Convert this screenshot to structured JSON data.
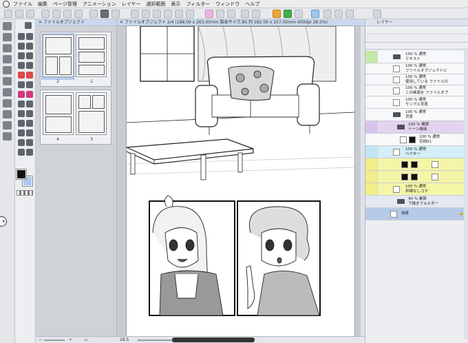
{
  "menu": {
    "items": [
      "ファイル",
      "編集",
      "ページ管理",
      "アニメーション",
      "レイヤー",
      "選択範囲",
      "表示",
      "フィルター",
      "ウィンドウ",
      "ヘルプ"
    ]
  },
  "page_manager": {
    "tab_label": "ファイルオブジェクト",
    "pages": [
      {
        "number": "2"
      },
      {
        "number": "1"
      },
      {
        "number": "4"
      },
      {
        "number": "3"
      }
    ]
  },
  "canvas": {
    "tab_label": "ファイルオブジェクト 2/4 (188.00 x 263.00mm 製本サイズ:85 判 182.00 x 257.00mm 600dpi 28.5%)",
    "zoom": "28.5"
  },
  "layer_panel": {
    "tab_label": "レイヤー",
    "layers": [
      {
        "line1": "100 % 通常",
        "line2": "テキスト",
        "tint": "#f5f5a8",
        "eye_color": "#c2e9a5"
      },
      {
        "line1": "100 % 通常",
        "line2": "ファイルオブジェクトに",
        "tint": "#f7f8fa",
        "eye_color": ""
      },
      {
        "line1": "100 % 通常",
        "line2": "使用している ファイルの",
        "tint": "#f7f8fa",
        "eye_color": ""
      },
      {
        "line1": "100 % 通常",
        "line2": "この画面を ファイルオブ",
        "tint": "#f7f8fa",
        "eye_color": ""
      },
      {
        "line1": "100 % 通常",
        "line2": "サンプル背景",
        "tint": "#f7f8fa",
        "eye_color": ""
      },
      {
        "line1": "100 % 通常",
        "line2": "背景",
        "tint": "#f7f8fa",
        "eye_color": ""
      },
      {
        "line1": "100 % 乗算",
        "line2": "トーン格納",
        "tint": "#e4d3ef",
        "eye_color": "#d9c3ea"
      },
      {
        "line1": "100 % 通常",
        "line2": "花柄01",
        "tint": "#f7f8fa",
        "eye_color": ""
      },
      {
        "line1": "100 % 通常",
        "line2": "ベクター",
        "tint": "#d3eef6",
        "eye_color": "#bfe6f2"
      },
      {
        "line1": "",
        "line2": "",
        "tint": "#f5f5a8",
        "eye_color": "#f3ee86"
      },
      {
        "line1": "",
        "line2": "",
        "tint": "#f5f5a8",
        "eye_color": "#f3ee86"
      },
      {
        "line1": "100 % 通常",
        "line2": "枠線なしコマ",
        "tint": "#f5f5a8",
        "eye_color": "#f3ee86"
      },
      {
        "line1": "40 % 乗算",
        "line2": "下描きフォルダー",
        "tint": "#e3e8f2",
        "eye_color": ""
      },
      {
        "line1": "",
        "line2": "用紙",
        "tint": "#b7cbe8",
        "eye_color": ""
      }
    ]
  }
}
